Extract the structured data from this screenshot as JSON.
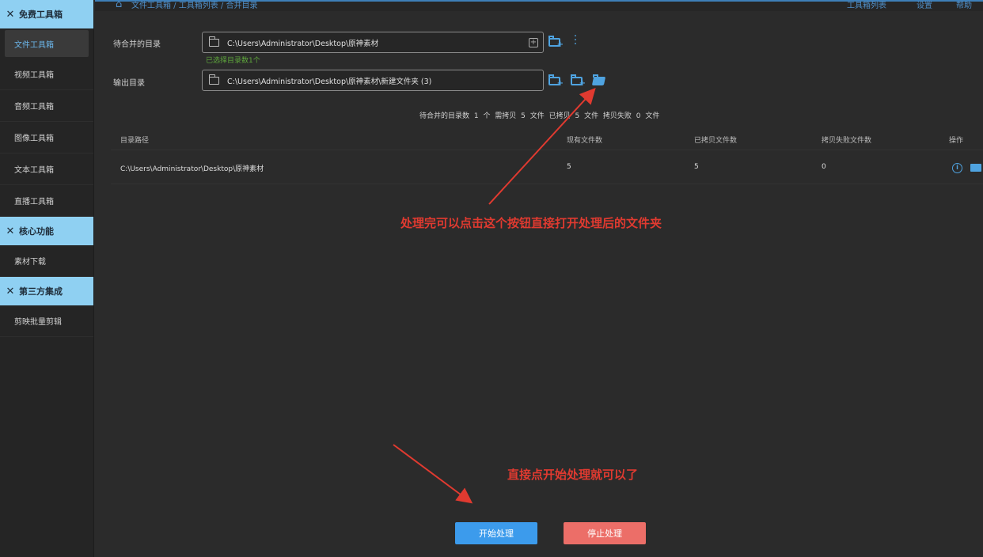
{
  "sidebar": {
    "sections": [
      {
        "title": "免费工具箱",
        "items": [
          "文件工具箱",
          "视频工具箱",
          "音频工具箱",
          "图像工具箱",
          "文本工具箱",
          "直播工具箱"
        ]
      },
      {
        "title": "核心功能",
        "items": [
          "素材下载"
        ]
      },
      {
        "title": "第三方集成",
        "items": [
          "剪映批量剪辑"
        ]
      }
    ],
    "active_item": "文件工具箱"
  },
  "topbar": {
    "breadcrumb": "文件工具箱 / 工具箱列表 / 合并目录",
    "menu": [
      "工具箱列表",
      "设置",
      "帮助"
    ]
  },
  "form": {
    "source_label": "待合并的目录",
    "source_path": "C:\\Users\\Administrator\\Desktop\\原神素材",
    "source_hint": "已选择目录数1个",
    "output_label": "输出目录",
    "output_path": "C:\\Users\\Administrator\\Desktop\\原神素材\\新建文件夹 (3)"
  },
  "stats": "待合并的目录数 1 个  需拷贝 5 文件  已拷贝 5 文件  拷贝失败 0 文件",
  "table": {
    "headers": [
      "目录路径",
      "现有文件数",
      "已拷贝文件数",
      "拷贝失败文件数",
      "操作"
    ],
    "rows": [
      {
        "path": "C:\\Users\\Administrator\\Desktop\\原神素材",
        "existing": "5",
        "copied": "5",
        "failed": "0"
      }
    ]
  },
  "annotations": {
    "open_folder_tip": "处理完可以点击这个按钮直接打开处理后的文件夹",
    "start_tip": "直接点开始处理就可以了"
  },
  "buttons": {
    "start": "开始处理",
    "stop": "停止处理"
  },
  "colors": {
    "accent": "#3c9bec",
    "sidebar_section": "#8fd0f2",
    "stop": "#ec6e68",
    "annotation": "#e03a30",
    "hint": "#5fa83c"
  }
}
